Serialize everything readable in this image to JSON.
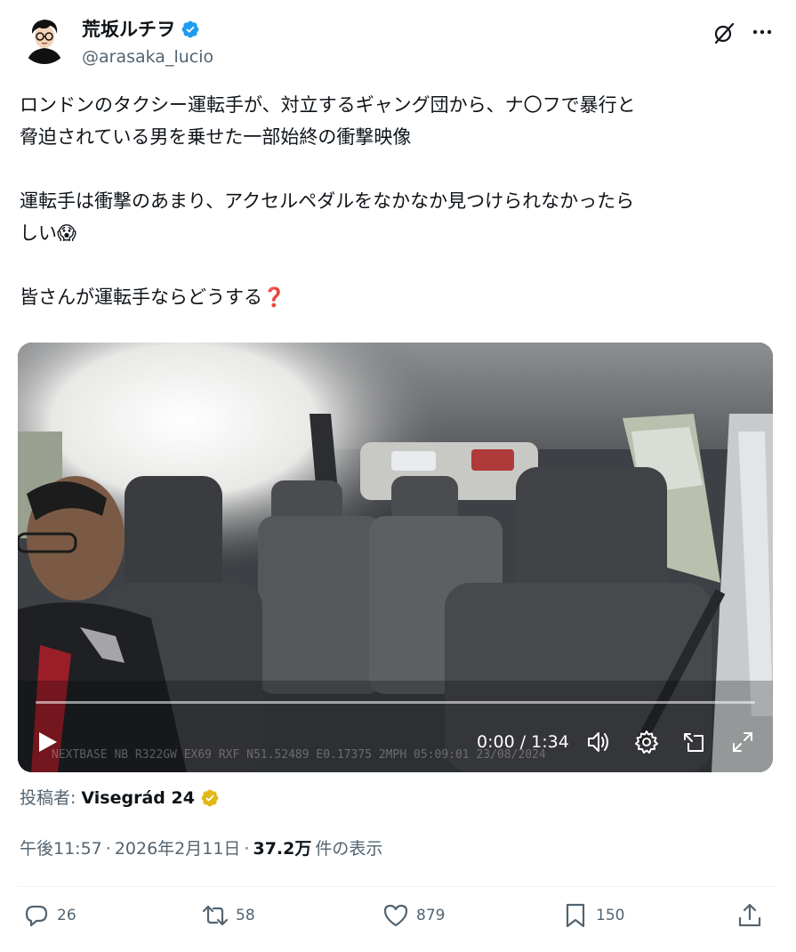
{
  "author": {
    "display_name": "荒坂ルチヲ",
    "handle": "@arasaka_lucio",
    "verified_color": "#1d9bf0"
  },
  "tweet": {
    "paragraphs": [
      [
        "ロンドンのタクシー運転手が、対立するギャング団から、ナ〇フで暴行と",
        "脅迫されている男を乗せた一部始終の衝撃映像"
      ],
      [
        "運転手は衝撃のあまり、アクセルペダルをなかなか見つけられなかったら",
        "しい😱"
      ],
      [
        "皆さんが運転手ならどうする❓"
      ]
    ]
  },
  "video": {
    "current_time": "0:00",
    "duration": "1:34",
    "time_display": "0:00 / 1:34",
    "progress": 0,
    "dashcam_overlay": "NEXTBASE   NB   R322GW    EX69 RXF     N51.52489  E0.17375   2MPH   05:09:01   23/08/2024"
  },
  "attribution": {
    "label": "投稿者:",
    "name": "Visegrád 24",
    "badge_color": "#e2b719"
  },
  "meta": {
    "time": "午後11:57",
    "sep1": "·",
    "date": "2026年2月11日",
    "sep2": "·",
    "views": "37.2万",
    "views_label": "件の表示"
  },
  "actions": {
    "replies": "26",
    "retweets": "58",
    "likes": "879",
    "bookmarks": "150"
  },
  "icons": [
    "grok-icon",
    "more-icon",
    "verified-badge-icon",
    "play-icon",
    "volume-icon",
    "settings-icon",
    "pip-icon",
    "fullscreen-icon",
    "reply-icon",
    "retweet-icon",
    "like-icon",
    "bookmark-icon",
    "share-icon"
  ],
  "colors": {
    "text_primary": "#0f1419",
    "text_secondary": "#536471",
    "accent": "#1d9bf0"
  }
}
